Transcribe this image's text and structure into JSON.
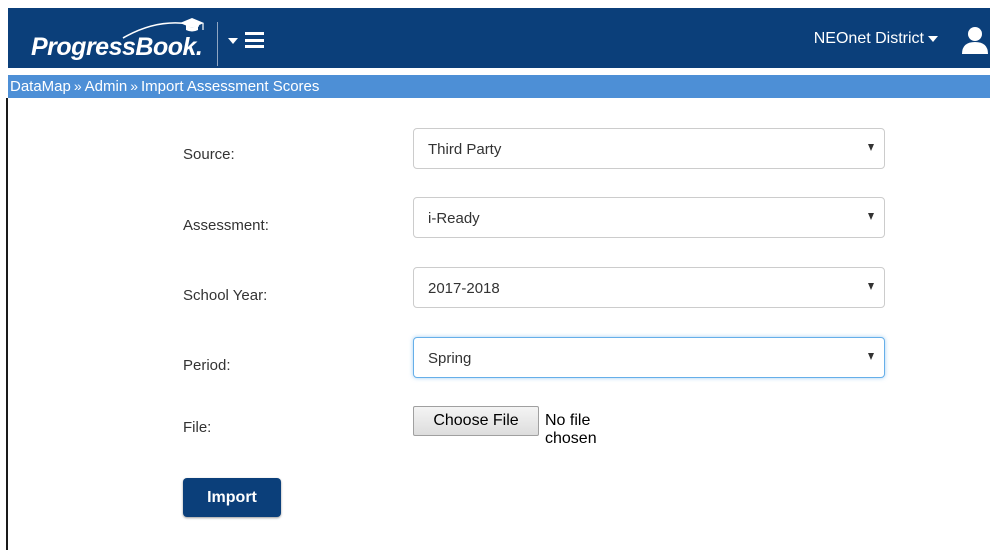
{
  "header": {
    "logo_text": "ProgressBook.",
    "district_label": "NEOnet District",
    "color": "#0b3f7a"
  },
  "breadcrumb": {
    "items": [
      "DataMap",
      "Admin",
      "Import Assessment Scores"
    ],
    "separator": "»",
    "color": "#4d8fd6"
  },
  "form": {
    "source": {
      "label": "Source:",
      "value": "Third Party"
    },
    "assessment": {
      "label": "Assessment:",
      "value": "i-Ready"
    },
    "school_year": {
      "label": "School Year:",
      "value": "2017-2018"
    },
    "period": {
      "label": "Period:",
      "value": "Spring"
    },
    "file": {
      "label": "File:",
      "button_label": "Choose File",
      "status": "No file chosen"
    },
    "import_label": "Import"
  },
  "icons": [
    "graduation-cap-icon",
    "chevron-down-icon",
    "hamburger-menu-icon",
    "user-icon"
  ]
}
